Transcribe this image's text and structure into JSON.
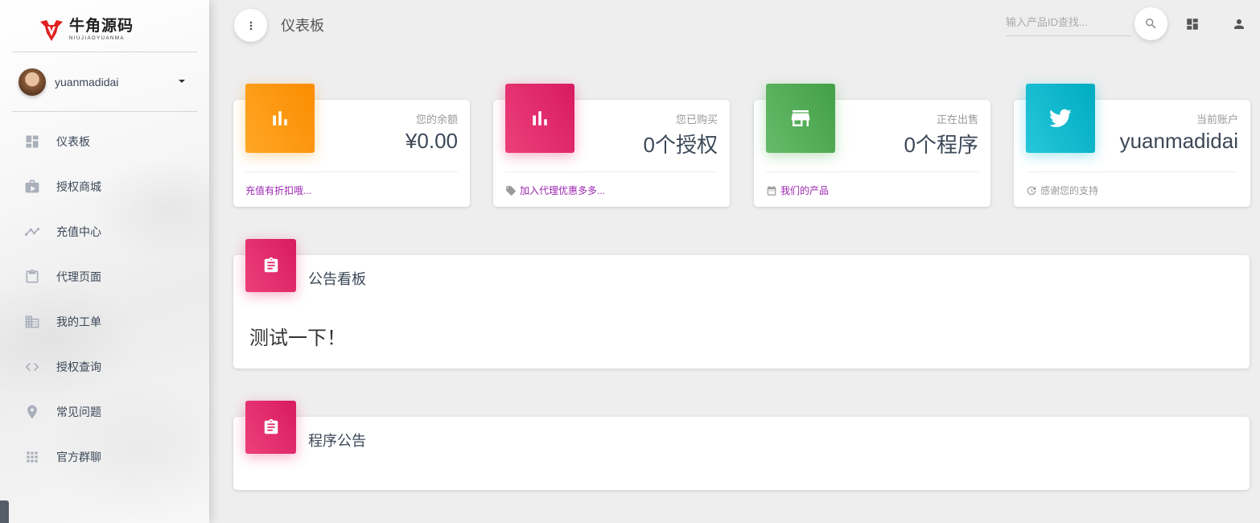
{
  "brand": {
    "name": "牛角源码",
    "subtitle": "NIUJIAOYUANMA",
    "accent": "#e02020"
  },
  "user": {
    "name": "yuanmadidai"
  },
  "sidebar": {
    "items": [
      {
        "label": "仪表板",
        "icon": "dashboard-icon"
      },
      {
        "label": "授权商城",
        "icon": "shopping-bag-icon"
      },
      {
        "label": "充值中心",
        "icon": "trending-up-icon"
      },
      {
        "label": "代理页面",
        "icon": "clipboard-icon"
      },
      {
        "label": "我的工单",
        "icon": "building-icon"
      },
      {
        "label": "授权查询",
        "icon": "code-icon"
      },
      {
        "label": "常见问题",
        "icon": "location-pin-icon"
      },
      {
        "label": "官方群聊",
        "icon": "apps-grid-icon"
      }
    ]
  },
  "header": {
    "title": "仪表板",
    "search": {
      "placeholder": "输入产品ID查找...",
      "value": ""
    }
  },
  "stats": [
    {
      "category": "您的余额",
      "value": "¥0.00",
      "footer": "充值有折扣哦...",
      "color": "#fb8c00",
      "icon": "bar-chart-icon",
      "footer_icon": ""
    },
    {
      "category": "您已购买",
      "value": "0个授权",
      "footer": "加入代理优惠多多...",
      "color": "#d81b60",
      "icon": "bar-chart-icon",
      "footer_icon": "tag-icon"
    },
    {
      "category": "正在出售",
      "value": "0个程序",
      "footer": "我们的产品",
      "color": "#43a047",
      "icon": "store-icon",
      "footer_icon": "calendar-icon"
    },
    {
      "category": "当前账户",
      "value": "yuanmadidai",
      "footer": "感谢您的支持",
      "color": "#00acc1",
      "icon": "twitter-bird-icon",
      "footer_icon": "update-icon"
    }
  ],
  "panels": {
    "announcement": {
      "title": "公告看板",
      "content": "测试一下！"
    },
    "program_notice": {
      "title": "程序公告",
      "content": ""
    }
  }
}
